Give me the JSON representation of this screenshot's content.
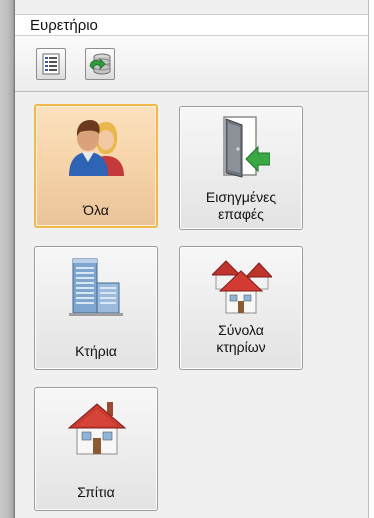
{
  "panel": {
    "title": "Ευρετήριο"
  },
  "toolbar": {
    "buttons": [
      {
        "icon": "list-icon"
      },
      {
        "icon": "database-refresh-icon"
      }
    ]
  },
  "tiles": [
    {
      "label": "Όλα",
      "icon": "people-icon",
      "selected": true
    },
    {
      "label_line1": "Εισηγμένες",
      "label_line2": "επαφές",
      "icon": "door-arrow-icon"
    },
    {
      "label": "Κτήρια",
      "icon": "building-icon"
    },
    {
      "label_line1": "Σύνολα",
      "label_line2": "κτηρίων",
      "icon": "houses-group-icon"
    },
    {
      "label": "Σπίτια",
      "icon": "house-icon"
    }
  ]
}
